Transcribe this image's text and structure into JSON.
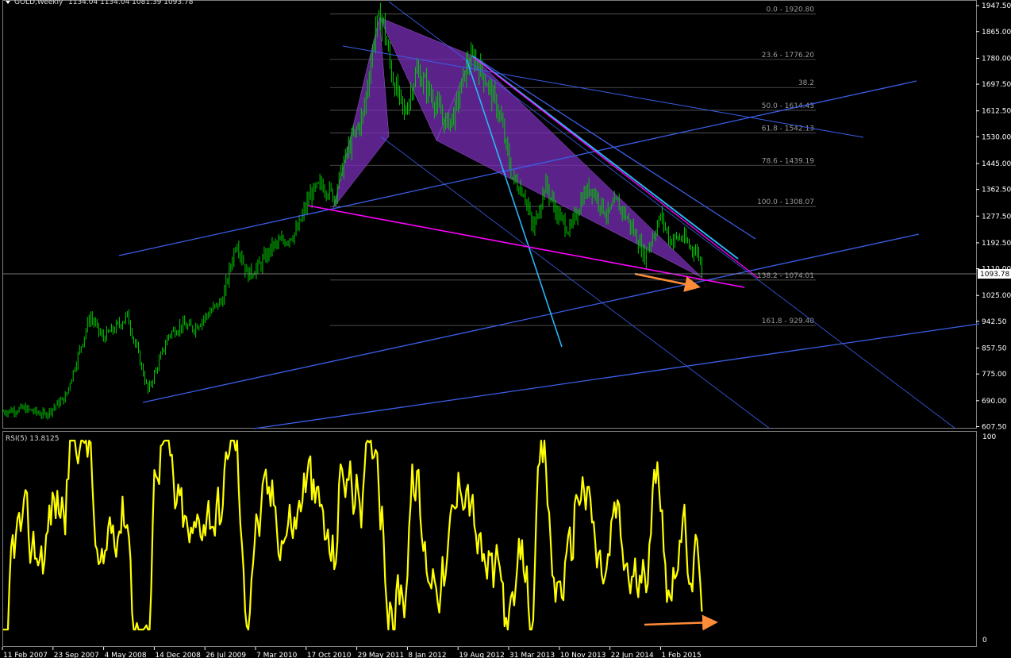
{
  "header": {
    "title": "GOLD,Weekly",
    "ohlc": "1134.04 1134.04 1081.39 1093.78"
  },
  "current_price_label": "1093.78",
  "rsi_label": "RSI(5) 13.8125",
  "colors": {
    "background": "#000000",
    "candles": "#00c800",
    "grid": "#5a5a5a",
    "trendline": "#3b5ee8",
    "trendline_light": "#4a8ff0",
    "cyan": "#29b6f6",
    "magenta": "#ff00ff",
    "pattern_fill": "#7a2fb8",
    "rsi": "#ffff00",
    "arrow": "#ff8c38",
    "axis_text": "#ffffff"
  },
  "chart_data": [
    {
      "type": "candlestick",
      "title": "GOLD,Weekly",
      "price_axis": [
        "1947.50",
        "1865.00",
        "1780.00",
        "1697.50",
        "1612.50",
        "1530.00",
        "1445.00",
        "1362.50",
        "1277.50",
        "1192.50",
        "1110.00",
        "1025.00",
        "942.50",
        "857.50",
        "775.00",
        "690.00",
        "607.50"
      ],
      "date_axis": [
        "11 Feb 2007",
        "23 Sep 2007",
        "4 May 2008",
        "14 Dec 2008",
        "26 Jul 2009",
        "7 Mar 2010",
        "17 Oct 2010",
        "29 May 2011",
        "8 Jan 2012",
        "19 Aug 2012",
        "31 Mar 2013",
        "10 Nov 2013",
        "22 Jun 2014",
        "1 Feb 2015"
      ],
      "ylim": [
        590,
        1965
      ],
      "price_path": [
        [
          2007.1,
          655
        ],
        [
          2007.35,
          665
        ],
        [
          2007.6,
          645
        ],
        [
          2007.85,
          700
        ],
        [
          2008.0,
          830
        ],
        [
          2008.15,
          960
        ],
        [
          2008.3,
          890
        ],
        [
          2008.45,
          920
        ],
        [
          2008.6,
          960
        ],
        [
          2008.75,
          820
        ],
        [
          2008.85,
          720
        ],
        [
          2008.95,
          790
        ],
        [
          2009.1,
          900
        ],
        [
          2009.25,
          930
        ],
        [
          2009.4,
          920
        ],
        [
          2009.55,
          960
        ],
        [
          2009.75,
          1010
        ],
        [
          2009.92,
          1200
        ],
        [
          2010.05,
          1090
        ],
        [
          2010.2,
          1120
        ],
        [
          2010.35,
          1180
        ],
        [
          2010.5,
          1200
        ],
        [
          2010.65,
          1230
        ],
        [
          2010.8,
          1340
        ],
        [
          2010.95,
          1380
        ],
        [
          2011.1,
          1340
        ],
        [
          2011.25,
          1480
        ],
        [
          2011.45,
          1600
        ],
        [
          2011.6,
          1880
        ],
        [
          2011.68,
          1910
        ],
        [
          2011.8,
          1720
        ],
        [
          2011.95,
          1600
        ],
        [
          2012.05,
          1700
        ],
        [
          2012.1,
          1740
        ],
        [
          2012.3,
          1650
        ],
        [
          2012.45,
          1570
        ],
        [
          2012.55,
          1600
        ],
        [
          2012.7,
          1760
        ],
        [
          2012.8,
          1780
        ],
        [
          2012.95,
          1700
        ],
        [
          2013.1,
          1600
        ],
        [
          2013.25,
          1400
        ],
        [
          2013.4,
          1350
        ],
        [
          2013.5,
          1230
        ],
        [
          2013.65,
          1380
        ],
        [
          2013.8,
          1280
        ],
        [
          2013.95,
          1230
        ],
        [
          2014.1,
          1340
        ],
        [
          2014.2,
          1370
        ],
        [
          2014.4,
          1280
        ],
        [
          2014.5,
          1320
        ],
        [
          2014.6,
          1290
        ],
        [
          2014.75,
          1210
        ],
        [
          2014.85,
          1150
        ],
        [
          2015.05,
          1280
        ],
        [
          2015.15,
          1200
        ],
        [
          2015.3,
          1210
        ],
        [
          2015.4,
          1180
        ],
        [
          2015.5,
          1160
        ],
        [
          2015.55,
          1094
        ]
      ],
      "fibonacci_levels": [
        {
          "label": "0.0 - 1920.80",
          "price": 1920.8
        },
        {
          "label": "23.6 - 1776.20",
          "price": 1776.2
        },
        {
          "label": "38.2",
          "price": 1686.9
        },
        {
          "label": "50.0 - 1614.43",
          "price": 1614.43
        },
        {
          "label": "61.8 - 1542.13",
          "price": 1542.13
        },
        {
          "label": "78.6 - 1439.19",
          "price": 1439.19
        },
        {
          "label": "100.0 - 1308.07",
          "price": 1308.07
        },
        {
          "label": "138.2 - 1074.01",
          "price": 1074.01
        },
        {
          "label": "161.8 - 929.40",
          "price": 929.4
        }
      ],
      "current_price": 1093.78
    },
    {
      "type": "line",
      "title": "RSI(5) 13.8125",
      "ylim": [
        0,
        100
      ],
      "axis_labels": [
        "100",
        "0"
      ],
      "last_value": 13.8125
    }
  ]
}
